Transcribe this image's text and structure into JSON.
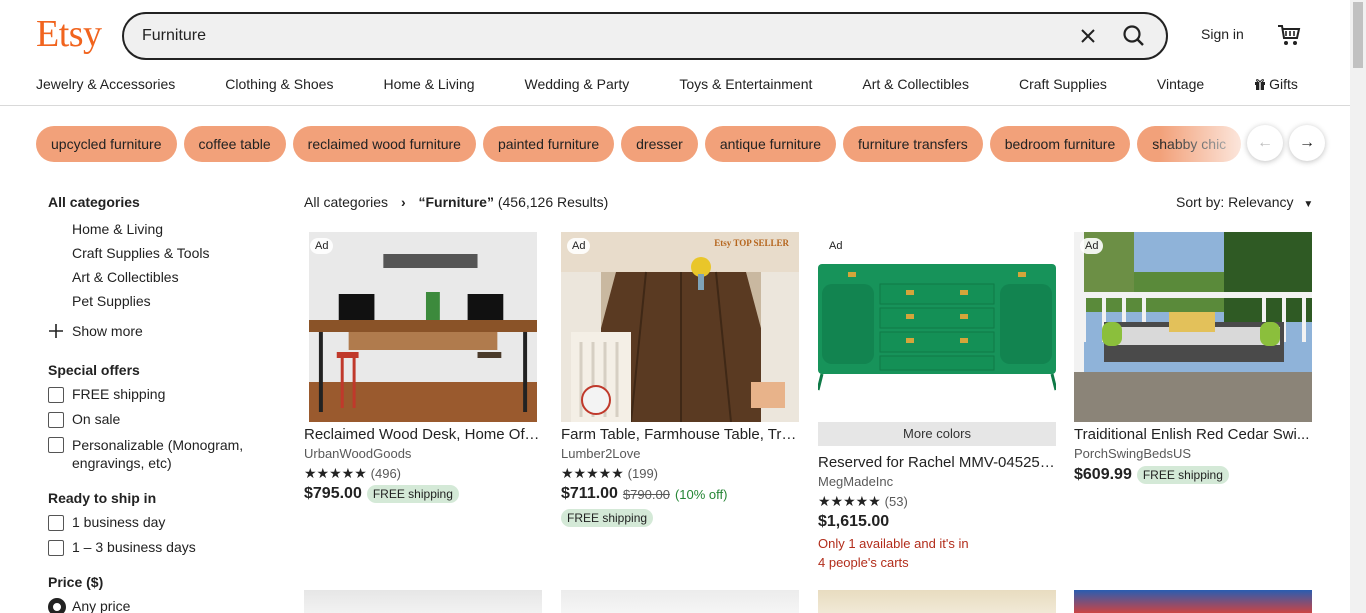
{
  "header": {
    "logo": "Etsy",
    "search_value": "Furniture",
    "signin": "Sign in"
  },
  "nav": [
    "Jewelry & Accessories",
    "Clothing & Shoes",
    "Home & Living",
    "Wedding & Party",
    "Toys & Entertainment",
    "Art & Collectibles",
    "Craft Supplies",
    "Vintage",
    "Gifts"
  ],
  "chips": [
    "upcycled furniture",
    "coffee table",
    "reclaimed wood furniture",
    "painted furniture",
    "dresser",
    "antique furniture",
    "furniture transfers",
    "bedroom furniture",
    "shabby chic"
  ],
  "sidebar": {
    "all_categories": "All categories",
    "categories": [
      "Home & Living",
      "Craft Supplies & Tools",
      "Art & Collectibles",
      "Pet Supplies"
    ],
    "show_more": "Show more",
    "special_offers": "Special offers",
    "offers": [
      "FREE shipping",
      "On sale",
      "Personalizable (Monogram, engravings, etc)"
    ],
    "ready_to_ship": "Ready to ship in",
    "ship_options": [
      "1 business day",
      "1 – 3 business days"
    ],
    "price_heading": "Price ($)",
    "price_option": "Any price"
  },
  "results": {
    "crumb_root": "All categories",
    "query": "“Furniture”",
    "count": "(456,126 Results)",
    "sort": "Sort by: Relevancy"
  },
  "listings": [
    {
      "ad": "Ad",
      "title": "Reclaimed Wood Desk, Home Offi...",
      "shop": "UrbanWoodGoods",
      "stars": "★★★★★",
      "reviews": "(496)",
      "price": "$795.00",
      "badge": "FREE shipping"
    },
    {
      "ad": "Ad",
      "title": "Farm Table, Farmhouse Table, Tre...",
      "shop": "Lumber2Love",
      "stars": "★★★★★",
      "reviews": "(199)",
      "price": "$711.00",
      "orig": "$790.00",
      "disc": "(10% off)",
      "badge": "FREE shipping",
      "img_text": "Etsy TOP SELLER"
    },
    {
      "ad": "Ad",
      "more_colors": "More colors",
      "title": "Reserved for Rachel MMV-04525-...",
      "shop": "MegMadeInc",
      "stars": "★★★★★",
      "reviews": "(53)",
      "price": "$1,615.00",
      "warn1": "Only 1 available and it's in",
      "warn2": "4 people's carts"
    },
    {
      "ad": "Ad",
      "title": "Traiditional Enlish Red Cedar Swi...",
      "shop": "PorchSwingBedsUS",
      "price": "$609.99",
      "badge": "FREE shipping"
    }
  ],
  "colors": {
    "brand": "#F1641E",
    "chip": "#F2A17A",
    "badge": "#D4E9D7",
    "warn": "#B22D1B"
  }
}
